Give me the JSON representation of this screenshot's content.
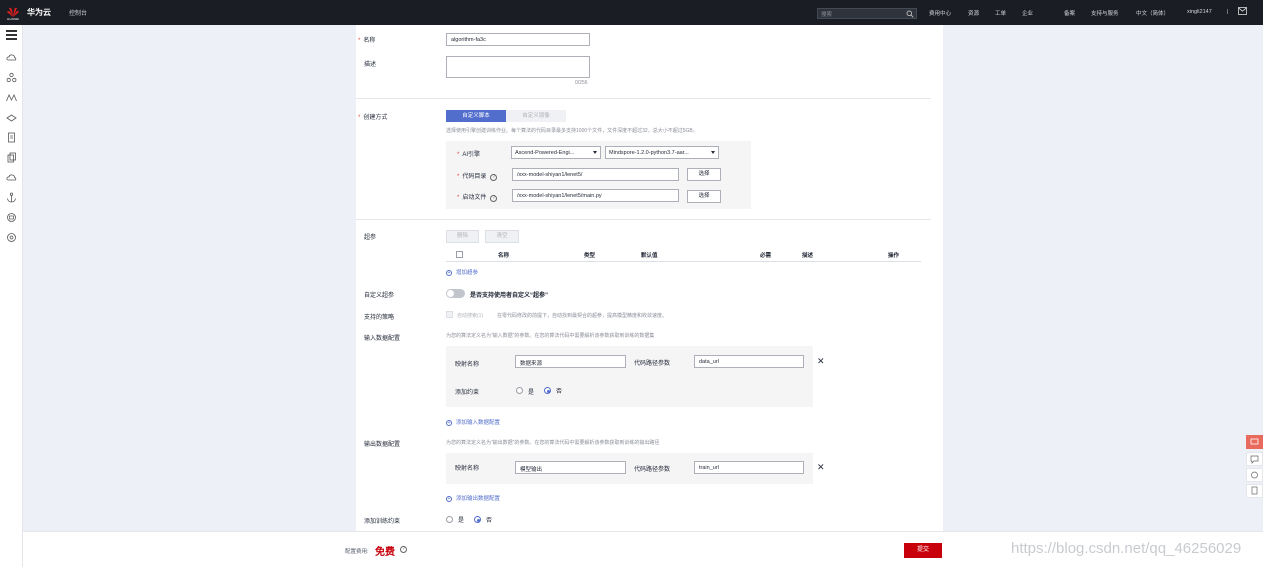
{
  "topbar": {
    "brand": "华为云",
    "console": "控制台",
    "search_placeholder": "搜索",
    "nav": [
      "费用中心",
      "资源",
      "工单",
      "企业",
      "备案",
      "支持与服务",
      "中文（简体）",
      "xingli2147",
      "|"
    ]
  },
  "form": {
    "name_label": "名称",
    "name_value": "algorithm-fa3c",
    "desc_label": "描述",
    "desc_counter": "0/256",
    "create_label": "创建方式",
    "tab_custom_script": "自定义脚本",
    "tab_custom_image": "自定义镜像",
    "create_hint": "选择使用引擎创建训练作业。每个算法的代码目录最多支持1000个文件，文件深度不超过32，总大小不超过5GB。",
    "ai_engine_label": "AI引擎",
    "engine_select": "Ascend-Powered-Engi...",
    "engine_version": "Mindspore-1.2.0-python3.7-aar...",
    "code_dir_label": "代码目录",
    "code_dir_value": "/xxx-model-shiyan1/lenet5/",
    "boot_file_label": "启动文件",
    "boot_file_value": "/xxx-model-shiyan1/lenet5/main.py",
    "choose_btn": "选择",
    "hyper_label": "超参",
    "delete_btn": "删除",
    "clear_btn": "清空",
    "table_headers": [
      "名称",
      "类型",
      "默认值",
      "必需",
      "描述",
      "操作"
    ],
    "add_hyper": "增加超参",
    "custom_hyper_label": "自定义超参",
    "custom_hyper_text": "是否支持使用者自定义“超参”",
    "strategy_label": "支持的策略",
    "strategy_checkbox": "自动搜索(1)",
    "strategy_hint": "在零代码修改的前提下，自动找到最契合的超参，提高模型精度和收敛速度。",
    "input_label": "输入数据配置",
    "input_hint": "为您的算法定义名为“输入数据”的参数。在您的算法代码中需要解析该参数获取到训练的数据集",
    "map_name_label": "映射名称",
    "input_map_value": "数据来源",
    "code_path_label": "代码路径参数",
    "input_path_value": "data_url",
    "add_constraint_label": "添加约束",
    "yes": "是",
    "no": "否",
    "add_input": "添加输入数据配置",
    "output_label": "输出数据配置",
    "output_hint": "为您的算法定义名为“输出数据”的参数。在您的算法代码中需要解析该参数获取到训练的输出路径",
    "output_map_value": "模型输出",
    "output_path_value": "train_url",
    "add_output": "添加输出数据配置",
    "train_constraint_label": "添加训练约束"
  },
  "footer": {
    "fee_label": "配置费用:",
    "fee_value": "免费",
    "submit": "提交",
    "watermark": "https://blog.csdn.net/qq_46256029"
  },
  "colors": {
    "accent": "#526ecc",
    "brand_red": "#c7000b",
    "topbar_bg": "#1a1d24"
  }
}
